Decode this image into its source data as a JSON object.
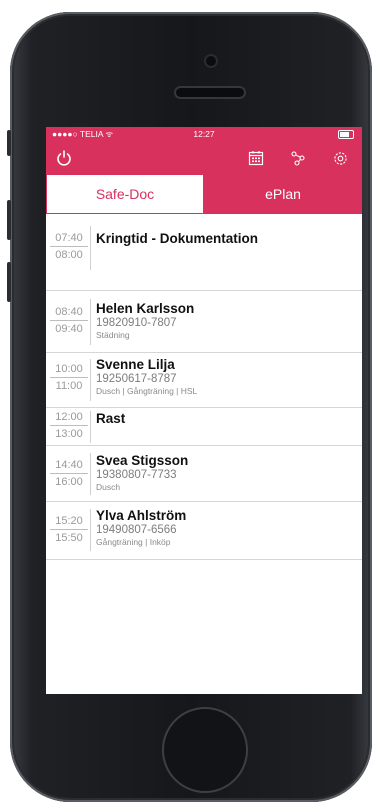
{
  "status": {
    "carrier": "●●●●○ TELIA ᯤ",
    "time": "12:27"
  },
  "toolbar": {
    "colors": {
      "accent": "#d8315d"
    },
    "icons": [
      "power-icon",
      "calendar-icon",
      "share-icon",
      "gear-icon"
    ]
  },
  "tabs": [
    {
      "label": "Safe-Doc",
      "active": true
    },
    {
      "label": "ePlan",
      "active": false
    }
  ],
  "rows": [
    {
      "start": "07:40",
      "end": "08:00",
      "name": "Kringtid - Dokumentation",
      "pid": "",
      "sub": ""
    },
    {
      "start": "08:40",
      "end": "09:40",
      "name": "Helen Karlsson",
      "pid": "19820910-7807",
      "sub": "Städning"
    },
    {
      "start": "10:00",
      "end": "11:00",
      "name": "Svenne Lilja",
      "pid": "19250617-8787",
      "sub": "Dusch | Gångträning | HSL"
    },
    {
      "start": "12:00",
      "end": "13:00",
      "name": "Rast",
      "pid": "",
      "sub": ""
    },
    {
      "start": "14:40",
      "end": "16:00",
      "name": "Svea Stigsson",
      "pid": "19380807-7733",
      "sub": "Dusch"
    },
    {
      "start": "15:20",
      "end": "15:50",
      "name": "Ylva Ahlström",
      "pid": "19490807-6566",
      "sub": "Gångträning | Inköp"
    }
  ]
}
